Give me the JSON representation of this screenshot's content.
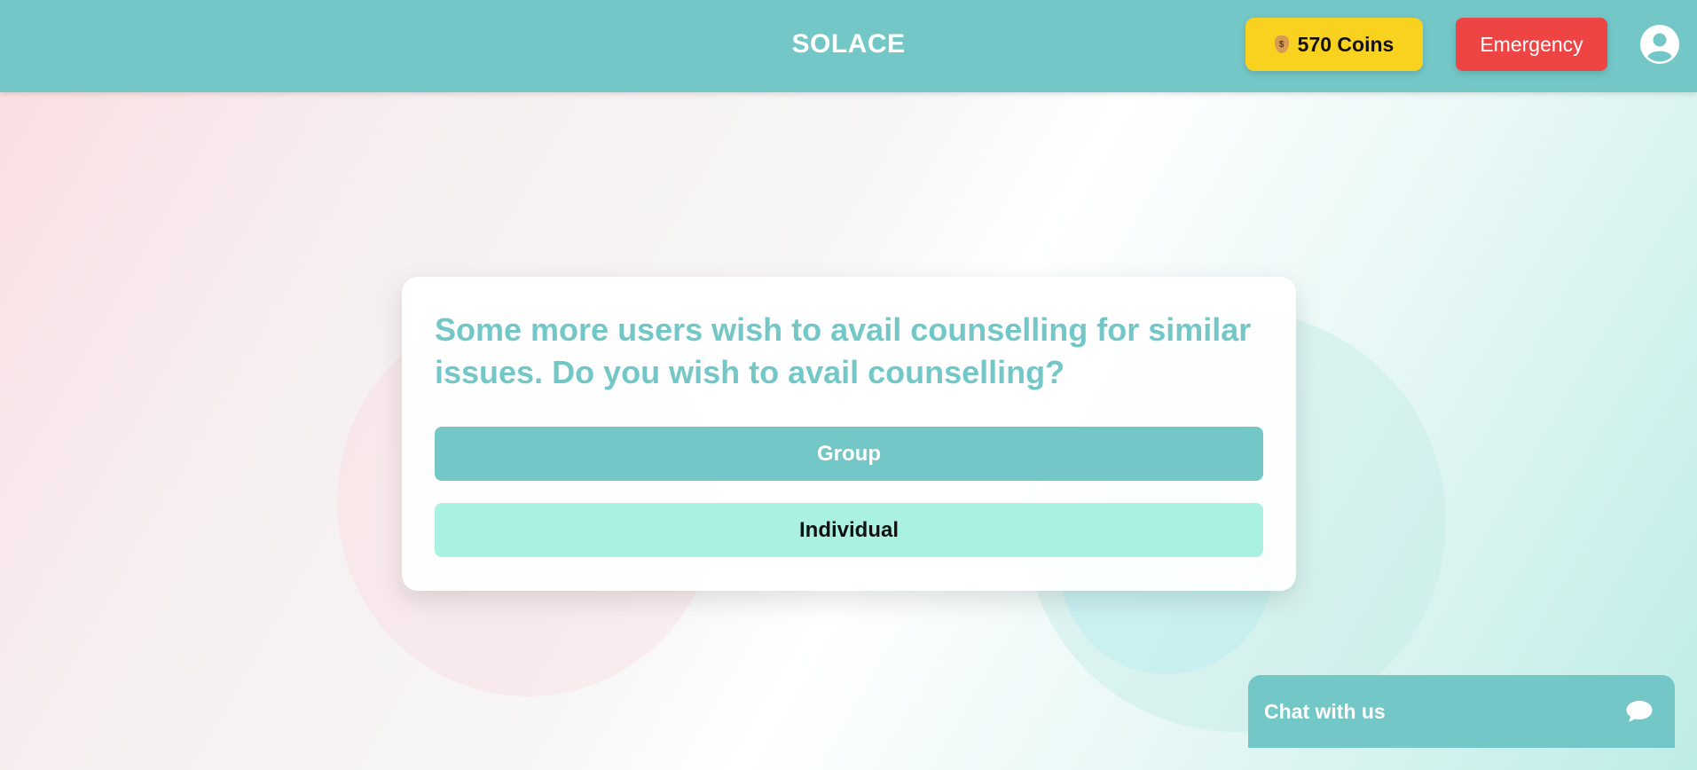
{
  "header": {
    "brand": "SOLACE",
    "coins_label": "570 Coins",
    "emergency_label": "Emergency"
  },
  "card": {
    "question": "Some more users wish to avail counselling for similar issues. Do you wish to avail counselling?",
    "options": [
      {
        "label": "Group"
      },
      {
        "label": "Individual"
      }
    ]
  },
  "chat": {
    "label": "Chat with us"
  },
  "icons": {
    "coins": "money-bag-icon",
    "profile": "user-circle-icon",
    "chat": "speech-bubble-icon"
  },
  "colors": {
    "primary": "#74c7c7",
    "coins_bg": "#f9d11f",
    "emergency_bg": "#ef4444",
    "individual_bg": "#aaf1e1"
  }
}
